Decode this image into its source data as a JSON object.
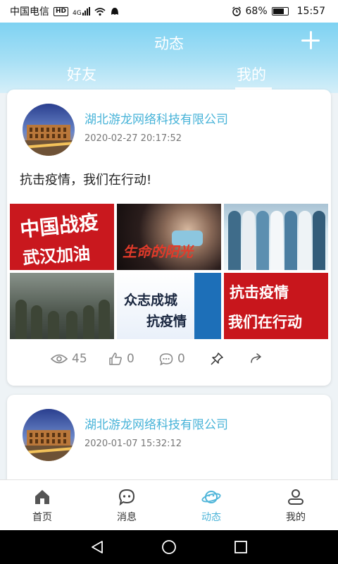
{
  "status_bar": {
    "carrier": "中国电信",
    "network_badge": "HD",
    "network_type": "4G",
    "battery": "68%",
    "time": "15:57"
  },
  "header": {
    "title": "动态",
    "tabs": [
      {
        "label": "好友",
        "active": false
      },
      {
        "label": "我的",
        "active": true
      }
    ]
  },
  "posts": [
    {
      "author": "湖北游龙网络科技有限公司",
      "time": "2020-02-27 20:17:52",
      "text": "抗击疫情，我们在行动!",
      "images": [
        {
          "lines": [
            "中国战疫",
            "武汉加油"
          ]
        },
        {
          "lines": [
            "生命的阳光"
          ]
        },
        {
          "lines": []
        },
        {
          "lines": []
        },
        {
          "lines": [
            "众志成城",
            "抗疫情"
          ]
        },
        {
          "lines": [
            "抗击疫情",
            "我们在行动"
          ]
        }
      ],
      "stats": {
        "views": "45",
        "likes": "0",
        "comments": "0"
      }
    },
    {
      "author": "湖北游龙网络科技有限公司",
      "time": "2020-01-07 15:32:12"
    }
  ],
  "tabbar": {
    "items": [
      {
        "label": "首页",
        "icon": "home-icon",
        "active": false
      },
      {
        "label": "消息",
        "icon": "message-icon",
        "active": false
      },
      {
        "label": "动态",
        "icon": "planet-icon",
        "active": true
      },
      {
        "label": "我的",
        "icon": "user-icon",
        "active": false
      }
    ]
  },
  "colors": {
    "accent": "#4fb5d9",
    "header_gradient_top": "#7ed2f2",
    "author_blue": "#47b3d8"
  }
}
